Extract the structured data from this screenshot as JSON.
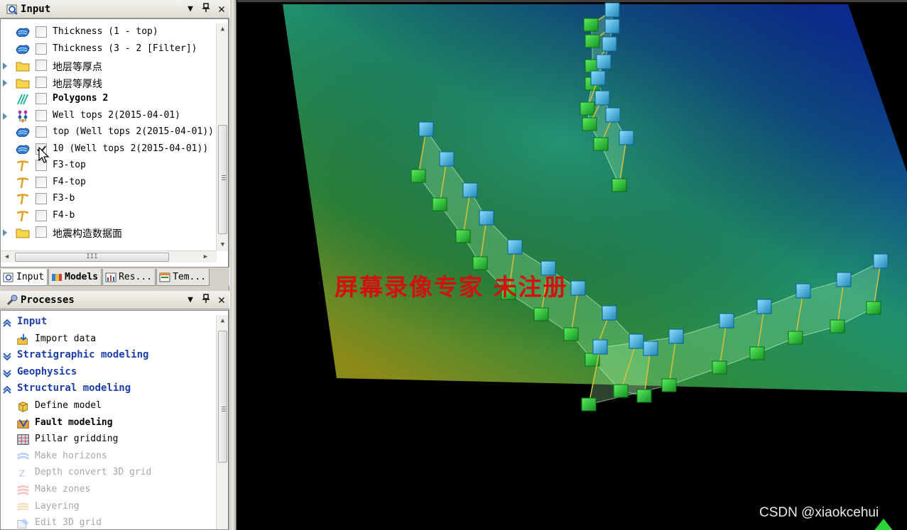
{
  "input_pane": {
    "title": "Input",
    "buttons": {
      "dropdown": "▼",
      "pin": "🖈",
      "close": "✕"
    },
    "items": [
      {
        "label": "Thickness (1 - top)",
        "icon": "surface-icon",
        "checked": false,
        "expandable": false
      },
      {
        "label": "Thickness (3 - 2 [Filter])",
        "icon": "surface-icon",
        "checked": false,
        "expandable": false
      },
      {
        "label": "地层等厚点",
        "icon": "folder-icon",
        "checked": false,
        "expandable": true
      },
      {
        "label": "地层等厚线",
        "icon": "folder-icon",
        "checked": false,
        "expandable": true
      },
      {
        "label": "Polygons 2",
        "icon": "polygon-icon",
        "checked": false,
        "expandable": false,
        "bold": true
      },
      {
        "label": "Well tops 2(2015-04-01)",
        "icon": "well-tops-icon",
        "checked": false,
        "expandable": true
      },
      {
        "label": "top (Well tops 2(2015-04-01))",
        "icon": "surface-icon",
        "checked": false,
        "expandable": false
      },
      {
        "label": "10 (Well tops 2(2015-04-01))",
        "icon": "surface-icon",
        "checked": true,
        "expandable": false
      },
      {
        "label": "F3-top",
        "icon": "fault-icon",
        "checked": false,
        "expandable": false
      },
      {
        "label": "F4-top",
        "icon": "fault-icon",
        "checked": false,
        "expandable": false
      },
      {
        "label": "F3-b",
        "icon": "fault-icon",
        "checked": false,
        "expandable": false
      },
      {
        "label": "F4-b",
        "icon": "fault-icon",
        "checked": false,
        "expandable": false
      },
      {
        "label": "地震构造数据面",
        "icon": "folder-icon",
        "checked": false,
        "expandable": true
      }
    ],
    "hscroll_grip": "III"
  },
  "tabs": [
    {
      "label": "Input",
      "icon": "input-tab-icon",
      "active": true,
      "bold": false
    },
    {
      "label": "Models",
      "icon": "models-tab-icon",
      "active": false,
      "bold": true
    },
    {
      "label": "Res...",
      "icon": "results-tab-icon",
      "active": false,
      "bold": false
    },
    {
      "label": "Tem...",
      "icon": "templates-tab-icon",
      "active": false,
      "bold": false
    }
  ],
  "processes_pane": {
    "title": "Processes",
    "rows": [
      {
        "type": "category",
        "label": "Input",
        "expanded": true
      },
      {
        "type": "process",
        "label": "Import data",
        "icon": "import-data-icon",
        "state": "normal"
      },
      {
        "type": "category",
        "label": "Stratigraphic modeling",
        "expanded": false
      },
      {
        "type": "category",
        "label": "Geophysics",
        "expanded": false
      },
      {
        "type": "category",
        "label": "Structural modeling",
        "expanded": true
      },
      {
        "type": "process",
        "label": "Define model",
        "icon": "define-model-icon",
        "state": "normal"
      },
      {
        "type": "process",
        "label": "Fault modeling",
        "icon": "fault-modeling-icon",
        "state": "bold"
      },
      {
        "type": "process",
        "label": "Pillar gridding",
        "icon": "pillar-gridding-icon",
        "state": "normal"
      },
      {
        "type": "process",
        "label": "Make horizons",
        "icon": "make-horizons-icon",
        "state": "disabled"
      },
      {
        "type": "process",
        "label": "Depth convert 3D grid",
        "icon": "depth-convert-icon",
        "state": "disabled"
      },
      {
        "type": "process",
        "label": "Make zones",
        "icon": "make-zones-icon",
        "state": "disabled"
      },
      {
        "type": "process",
        "label": "Layering",
        "icon": "layering-icon",
        "state": "disabled"
      },
      {
        "type": "process",
        "label": "Edit 3D grid",
        "icon": "edit-3d-grid-icon",
        "state": "disabled"
      }
    ]
  },
  "viewport": {
    "watermark": "屏幕录像专家  未注册",
    "credit": "CSDN @xiaokcehui",
    "colors": {
      "surface_top": "#0b2a8c",
      "surface_mid": "#1f8f6e",
      "surface_bottom": "#8a8a1a",
      "pillar_top": "#3fb6e0",
      "pillar_bottom": "#2fc43a",
      "fault_plane": "#9df2a0",
      "watermark": "#d40f0f"
    }
  }
}
